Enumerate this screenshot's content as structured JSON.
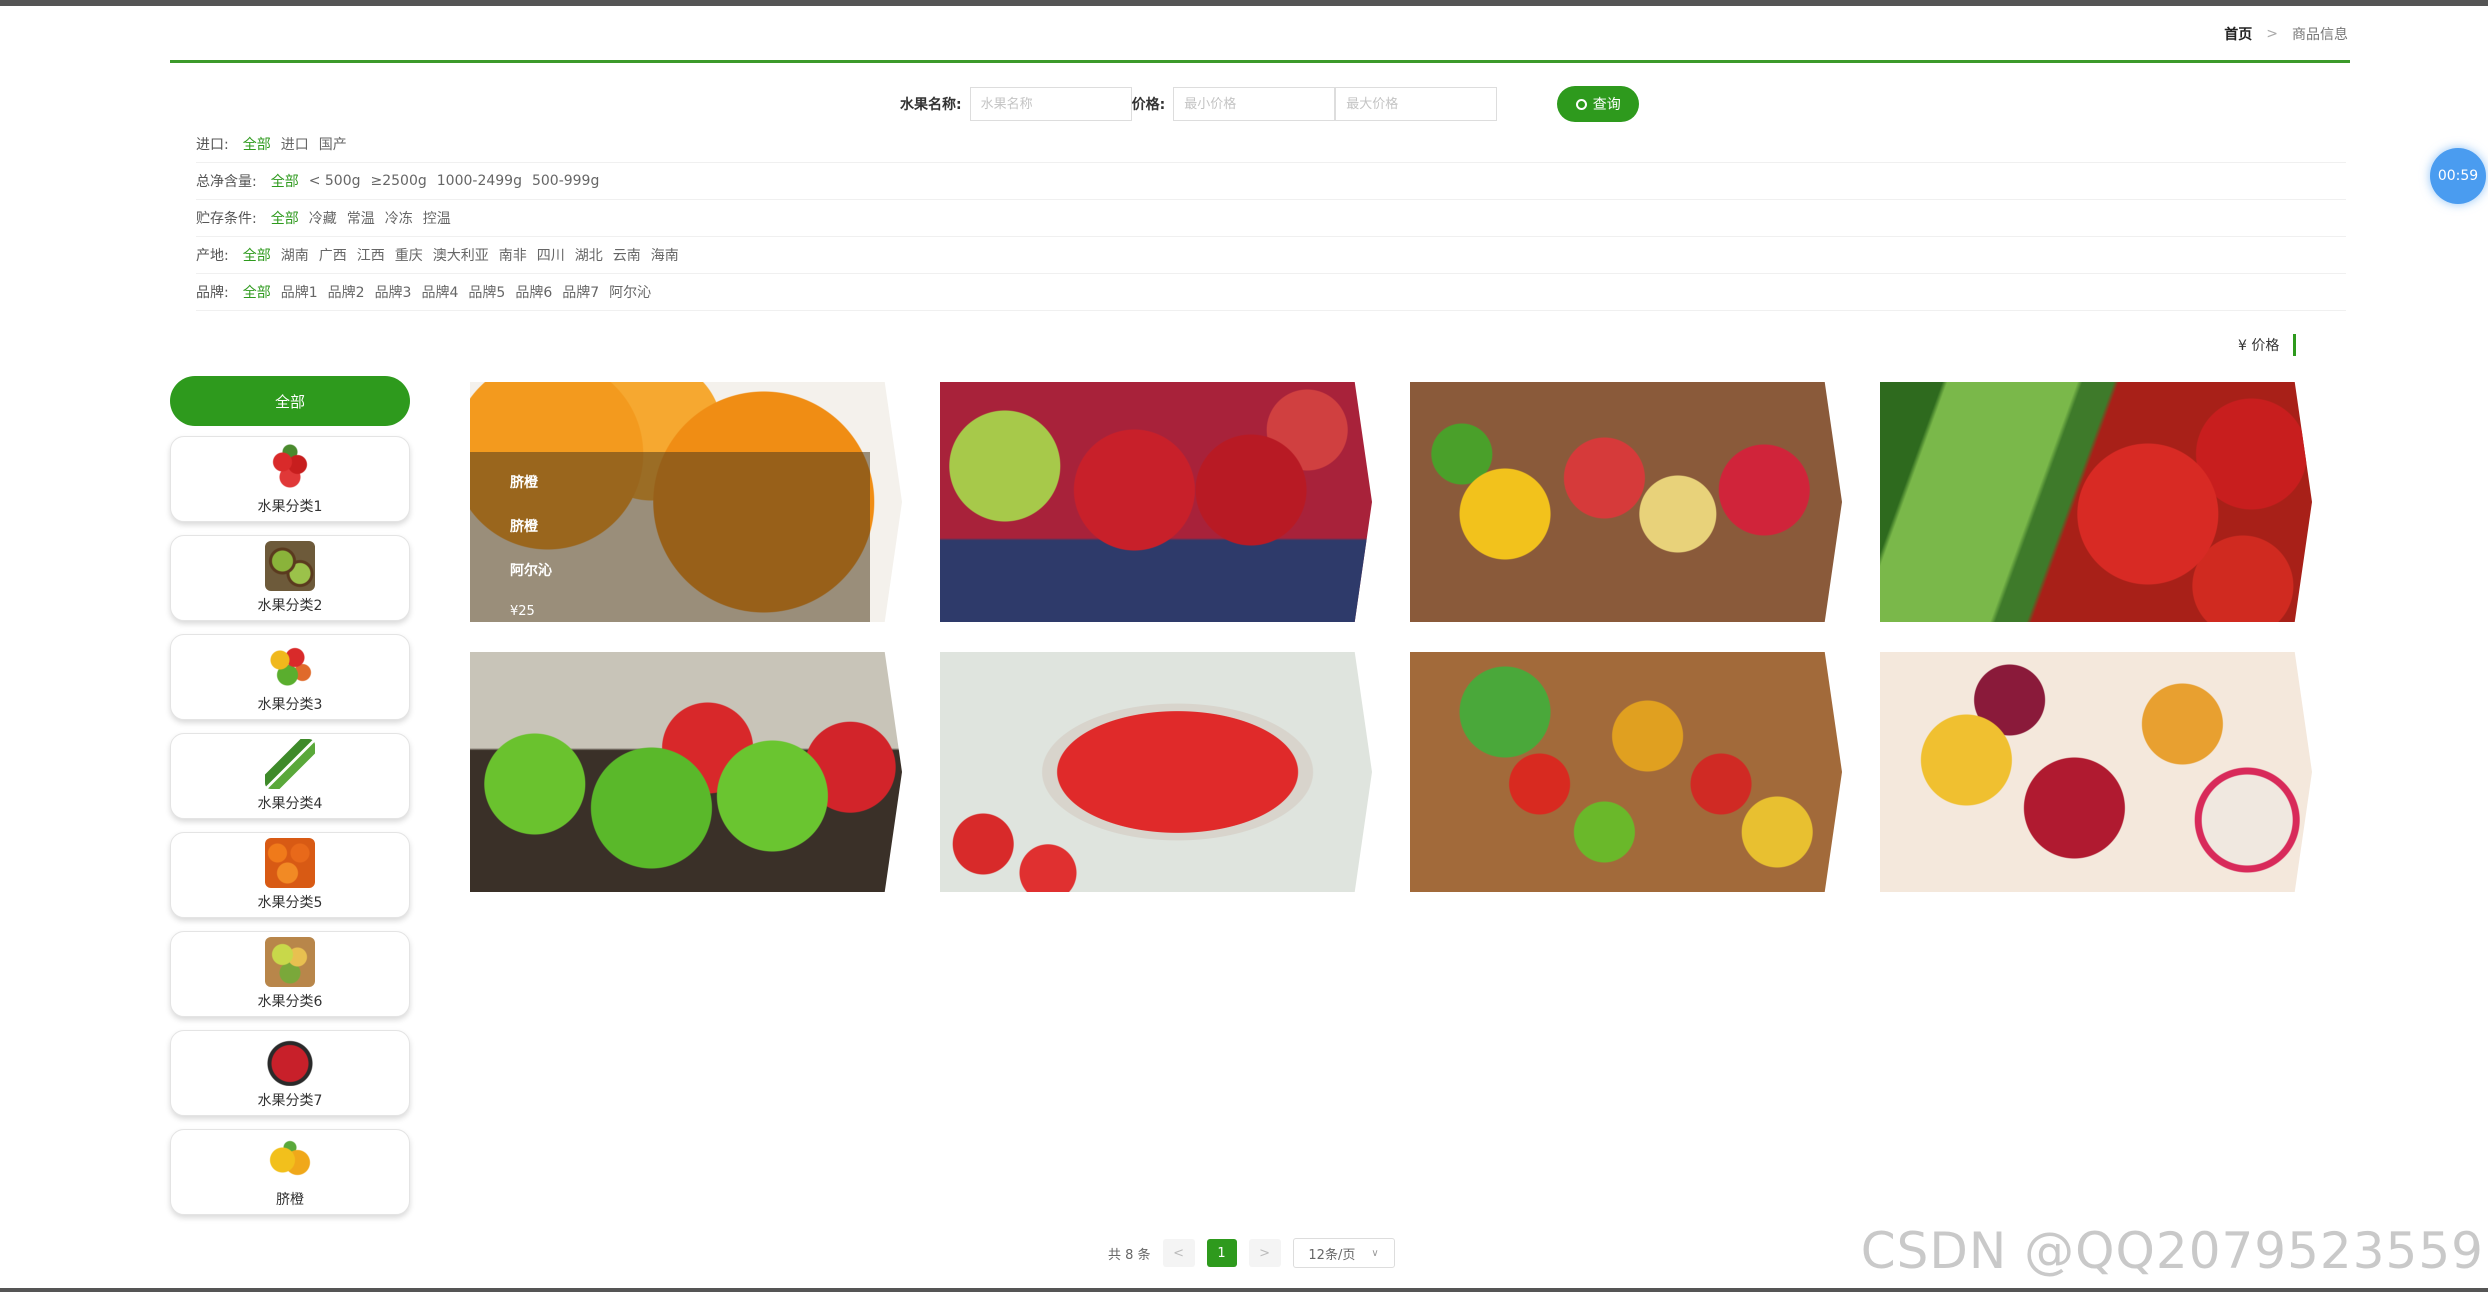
{
  "breadcrumb": {
    "home": "首页",
    "separator": ">",
    "current": "商品信息"
  },
  "search": {
    "name_label": "水果名称:",
    "name_placeholder": "水果名称",
    "price_label": "价格:",
    "min_placeholder": "最小价格",
    "max_placeholder": "最大价格",
    "button_label": "查询"
  },
  "filters": [
    {
      "label": "进口:",
      "options": [
        "全部",
        "进口",
        "国产"
      ]
    },
    {
      "label": "总净含量:",
      "options": [
        "全部",
        "< 500g",
        "≥2500g",
        "1000-2499g",
        "500-999g"
      ]
    },
    {
      "label": "贮存条件:",
      "options": [
        "全部",
        "冷藏",
        "常温",
        "冷冻",
        "控温"
      ]
    },
    {
      "label": "产地:",
      "options": [
        "全部",
        "湖南",
        "广西",
        "江西",
        "重庆",
        "澳大利亚",
        "南非",
        "四川",
        "湖北",
        "云南",
        "海南"
      ]
    },
    {
      "label": "品牌:",
      "options": [
        "全部",
        "品牌1",
        "品牌2",
        "品牌3",
        "品牌4",
        "品牌5",
        "品牌6",
        "品牌7",
        "阿尔沁"
      ]
    }
  ],
  "timer": "00:59",
  "sort": {
    "label": "¥ 价格"
  },
  "sidebar": {
    "all_label": "全部",
    "categories": [
      {
        "label": "水果分类1",
        "icon": "strawberry-basket-icon"
      },
      {
        "label": "水果分类2",
        "icon": "kiwi-icon"
      },
      {
        "label": "水果分类3",
        "icon": "mixed-fruit-icon"
      },
      {
        "label": "水果分类4",
        "icon": "cucumber-icon"
      },
      {
        "label": "水果分类5",
        "icon": "orange-pile-icon"
      },
      {
        "label": "水果分类6",
        "icon": "fruit-bowl-icon"
      },
      {
        "label": "水果分类7",
        "icon": "cherry-bowl-icon"
      },
      {
        "label": "脐橙",
        "icon": "orange-icon"
      }
    ]
  },
  "products": [
    {
      "image": "oranges",
      "hover": true,
      "name": "脐橙",
      "category": "脐橙",
      "brand": "阿尔沁",
      "price": "¥25"
    },
    {
      "image": "apples-blueberries"
    },
    {
      "image": "tropical-fruits"
    },
    {
      "image": "cucumber-tomato"
    },
    {
      "image": "green-apples-garden"
    },
    {
      "image": "strawberry-bowl"
    },
    {
      "image": "vegetables-table"
    },
    {
      "image": "fruit-basket"
    }
  ],
  "pager": {
    "total": "共 8 条",
    "prev": "<",
    "current": "1",
    "next": ">",
    "size": "12条/页"
  },
  "watermark": "CSDN @QQ2079523559",
  "colors": {
    "accent": "#2e9a1d",
    "timer": "#4a9cf0"
  }
}
